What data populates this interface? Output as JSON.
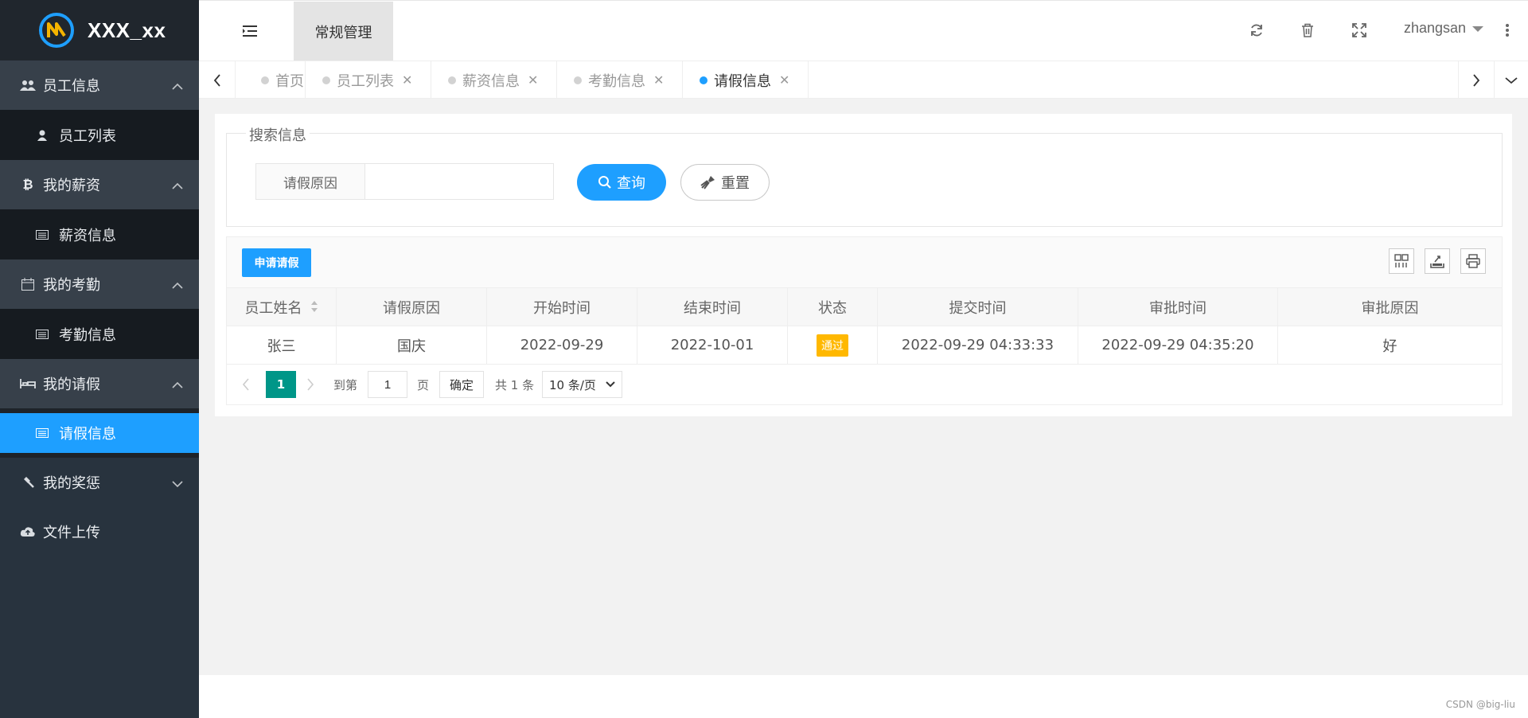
{
  "app": {
    "title": "XXX_xx"
  },
  "sidebar": {
    "groups": [
      {
        "label": "员工信息",
        "icon": "users-icon",
        "expanded": true,
        "items": [
          {
            "label": "员工列表",
            "icon": "user-icon"
          }
        ]
      },
      {
        "label": "我的薪资",
        "icon": "bitcoin-icon",
        "expanded": true,
        "items": [
          {
            "label": "薪资信息",
            "icon": "list-icon"
          }
        ]
      },
      {
        "label": "我的考勤",
        "icon": "calendar-icon",
        "expanded": true,
        "items": [
          {
            "label": "考勤信息",
            "icon": "list-icon"
          }
        ]
      },
      {
        "label": "我的请假",
        "icon": "bed-icon",
        "expanded": true,
        "items": [
          {
            "label": "请假信息",
            "icon": "list-icon",
            "active": true
          }
        ]
      },
      {
        "label": "我的奖惩",
        "icon": "gavel-icon",
        "expanded": false
      },
      {
        "label": "文件上传",
        "icon": "cloud-upload-icon"
      }
    ]
  },
  "header": {
    "top_tab": "常规管理",
    "user": "zhangsan"
  },
  "tabs": [
    {
      "label": "首页",
      "closable": false
    },
    {
      "label": "员工列表",
      "closable": true
    },
    {
      "label": "薪资信息",
      "closable": true
    },
    {
      "label": "考勤信息",
      "closable": true
    },
    {
      "label": "请假信息",
      "closable": true,
      "active": true
    }
  ],
  "search": {
    "legend": "搜索信息",
    "field_label": "请假原因",
    "field_value": "",
    "query_button": "查询",
    "reset_button": "重置"
  },
  "toolbar": {
    "apply_button": "申请请假"
  },
  "table": {
    "columns": [
      "员工姓名",
      "请假原因",
      "开始时间",
      "结束时间",
      "状态",
      "提交时间",
      "审批时间",
      "审批原因"
    ],
    "rows": [
      [
        "张三",
        "国庆",
        "2022-09-29",
        "2022-10-01",
        "通过",
        "2022-09-29 04:33:33",
        "2022-09-29 04:35:20",
        "好"
      ]
    ]
  },
  "pagination": {
    "current_page": "1",
    "goto_label": "到第",
    "goto_value": "1",
    "page_suffix": "页",
    "confirm": "确定",
    "total": "共 1 条",
    "page_size": "10 条/页"
  },
  "footer": {
    "credit": "CSDN @big-liu"
  },
  "colors": {
    "accent": "#1e9fff",
    "sidebar": "#28333e",
    "success_badge": "#ffb800",
    "page_active": "#009688"
  }
}
